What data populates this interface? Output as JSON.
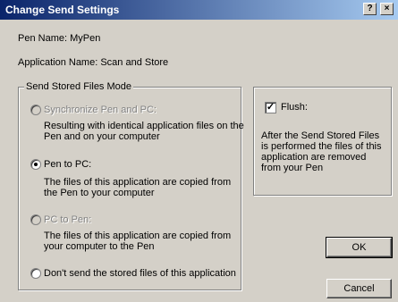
{
  "window": {
    "title": "Change Send Settings",
    "help_glyph": "?",
    "close_glyph": "×"
  },
  "info": {
    "pen_name": "Pen Name: MyPen",
    "application_name": "Application Name: Scan and Store"
  },
  "mode_group": {
    "legend": "Send Stored Files Mode",
    "options": [
      {
        "label": "Synchronize Pen and PC:",
        "description": "Resulting with identical application files on the Pen and on your computer",
        "enabled": false,
        "selected": false
      },
      {
        "label": "Pen to PC:",
        "description": "The files of this application are copied from the Pen to your computer",
        "enabled": true,
        "selected": true
      },
      {
        "label": "PC to Pen:",
        "description": "The files of this application are copied from your computer to the Pen",
        "enabled": false,
        "selected": false
      },
      {
        "label": "Don't send the stored files of this application",
        "description": "",
        "enabled": true,
        "selected": false
      }
    ]
  },
  "flush_group": {
    "checkbox_label": "Flush:",
    "checked": true,
    "check_glyph": "✓",
    "description": "After the Send Stored Files is performed the files of this application are removed from your Pen"
  },
  "buttons": {
    "ok": "OK",
    "cancel": "Cancel"
  }
}
